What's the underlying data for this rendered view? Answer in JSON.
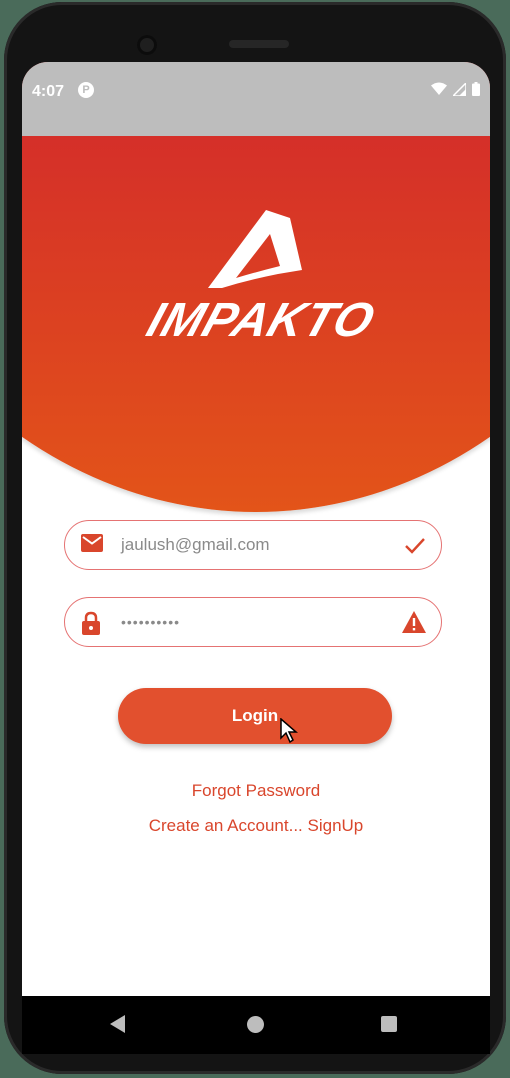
{
  "status_bar": {
    "time": "4:07",
    "notification_icon": "P"
  },
  "brand": {
    "name": "IMPAKTO",
    "primary_color": "#d32a2a",
    "accent_color": "#e2502e"
  },
  "login_form": {
    "email_value": "jaulush@gmail.com",
    "email_icon": "mail-icon",
    "email_status_icon": "checkmark-icon",
    "password_value": "••••••••••",
    "password_icon": "lock-icon",
    "password_status_icon": "warning-icon",
    "login_label": "Login"
  },
  "links": {
    "forgot_password": "Forgot Password",
    "create_account": "Create an Account... SignUp"
  }
}
